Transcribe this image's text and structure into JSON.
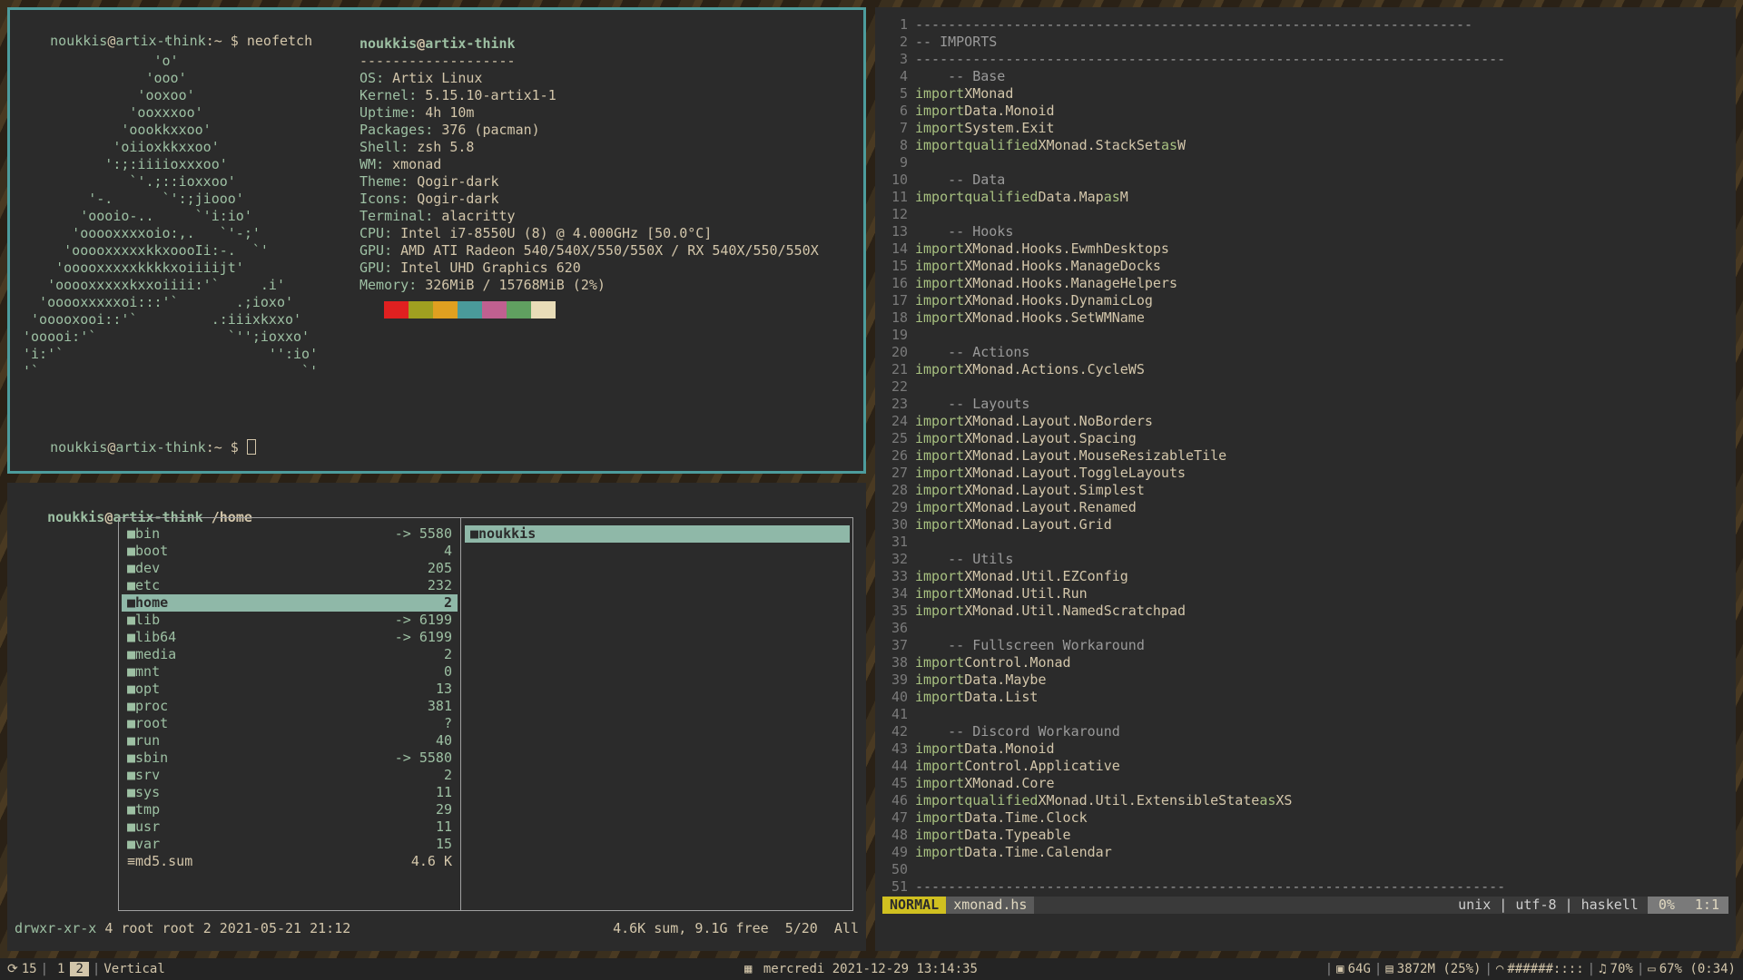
{
  "terminal": {
    "prompt_user": "noukkis",
    "prompt_at": "@",
    "prompt_host": "artix-think",
    "prompt_tail": ":~ $ ",
    "command": "neofetch",
    "logo_lines": [
      "                 '",
      "                'o'",
      "               'ooo'",
      "              'ooxoo'",
      "             'ooxxxoo'",
      "            'oookkxxoo'",
      "           'oiioxkkxxoo'",
      "          ':;:iiiioxxxoo'",
      "             `'.;::ioxxoo'",
      "        '-.      `':;jiooo'",
      "       'oooio-..     `'i:io'",
      "      'ooooxxxxoio:,.   `'-;'",
      "     'ooooxxxxxkkxoooIi:-.  `'",
      "    'ooooxxxxxkkkkxoiiiijt'",
      "   'ooooxxxxxkxxoiiii:'`     .i'",
      "  'ooooxxxxxoi:::'`       .;ioxo'",
      " 'ooooxooi::'`         .:iiixkxxo'",
      "'ooooi:'`                `'';ioxxo'",
      "'i:'`                         '':io'",
      "'`                                `'"
    ],
    "info_title_user": "noukkis",
    "info_title_at": "@",
    "info_title_host": "artix-think",
    "info_sep": "-------------------",
    "info": [
      {
        "k": "OS",
        "v": "Artix Linux"
      },
      {
        "k": "Kernel",
        "v": "5.15.10-artix1-1"
      },
      {
        "k": "Uptime",
        "v": "4h 10m"
      },
      {
        "k": "Packages",
        "v": "376 (pacman)"
      },
      {
        "k": "Shell",
        "v": "zsh 5.8"
      },
      {
        "k": "WM",
        "v": "xmonad"
      },
      {
        "k": "Theme",
        "v": "Qogir-dark"
      },
      {
        "k": "Icons",
        "v": "Qogir-dark"
      },
      {
        "k": "Terminal",
        "v": "alacritty"
      },
      {
        "k": "CPU",
        "v": "Intel i7-8550U (8) @ 4.000GHz [50.0°C]"
      },
      {
        "k": "GPU",
        "v": "AMD ATI Radeon 540/540X/550/550X / RX 540X/550/550X"
      },
      {
        "k": "GPU",
        "v": "Intel UHD Graphics 620"
      },
      {
        "k": "Memory",
        "v": "326MiB / 15768MiB (2%)"
      }
    ],
    "swatch_colors": [
      "#e02020",
      "#a0a020",
      "#e0a020",
      "#4a9a9a",
      "#c06090",
      "#60a060",
      "#e8dcb8"
    ]
  },
  "filemanager": {
    "title_user": "noukkis",
    "title_host": "artix-think",
    "title_path": "/home",
    "entries": [
      {
        "name": "bin",
        "size": "-> 5580",
        "type": "dir"
      },
      {
        "name": "boot",
        "size": "4",
        "type": "dir"
      },
      {
        "name": "dev",
        "size": "205",
        "type": "dir"
      },
      {
        "name": "etc",
        "size": "232",
        "type": "dir"
      },
      {
        "name": "home",
        "size": "2",
        "type": "dir",
        "selected": true
      },
      {
        "name": "lib",
        "size": "-> 6199",
        "type": "dir"
      },
      {
        "name": "lib64",
        "size": "-> 6199",
        "type": "dir"
      },
      {
        "name": "media",
        "size": "2",
        "type": "dir"
      },
      {
        "name": "mnt",
        "size": "0",
        "type": "dir"
      },
      {
        "name": "opt",
        "size": "13",
        "type": "dir"
      },
      {
        "name": "proc",
        "size": "381",
        "type": "dir"
      },
      {
        "name": "root",
        "size": "?",
        "type": "dir"
      },
      {
        "name": "run",
        "size": "40",
        "type": "dir"
      },
      {
        "name": "sbin",
        "size": "-> 5580",
        "type": "dir"
      },
      {
        "name": "srv",
        "size": "2",
        "type": "dir"
      },
      {
        "name": "sys",
        "size": "11",
        "type": "dir"
      },
      {
        "name": "tmp",
        "size": "29",
        "type": "dir"
      },
      {
        "name": "usr",
        "size": "11",
        "type": "dir"
      },
      {
        "name": "var",
        "size": "15",
        "type": "dir"
      },
      {
        "name": "md5.sum",
        "size": "4.6 K",
        "type": "file"
      }
    ],
    "preview": [
      {
        "name": "noukkis",
        "type": "dir"
      }
    ],
    "status_perm": "drwxr-xr-x",
    "status_info": " 4 root root 2 2021-05-21 21:12",
    "status_right": "4.6K sum, 9.1G free  5/20  All"
  },
  "editor": {
    "lines": [
      {
        "n": "1",
        "t": "cm",
        "s": "--------------------------------------------------------------------"
      },
      {
        "n": "2",
        "t": "cm",
        "s": "-- IMPORTS"
      },
      {
        "n": "3",
        "t": "cm",
        "s": "------------------------------------------------------------------------"
      },
      {
        "n": "4",
        "t": "cm",
        "s": "    -- Base"
      },
      {
        "n": "5",
        "t": "imp",
        "m": "XMonad"
      },
      {
        "n": "6",
        "t": "imp",
        "m": "Data.Monoid"
      },
      {
        "n": "7",
        "t": "imp",
        "m": "System.Exit"
      },
      {
        "n": "8",
        "t": "impq",
        "m": "XMonad.StackSet",
        "a": "W"
      },
      {
        "n": "9",
        "t": "blank",
        "s": ""
      },
      {
        "n": "10",
        "t": "cm",
        "s": "    -- Data"
      },
      {
        "n": "11",
        "t": "impq",
        "m": "Data.Map",
        "a": "M"
      },
      {
        "n": "12",
        "t": "blank",
        "s": ""
      },
      {
        "n": "13",
        "t": "cm",
        "s": "    -- Hooks"
      },
      {
        "n": "14",
        "t": "imp",
        "m": "XMonad.Hooks.EwmhDesktops"
      },
      {
        "n": "15",
        "t": "imp",
        "m": "XMonad.Hooks.ManageDocks"
      },
      {
        "n": "16",
        "t": "imp",
        "m": "XMonad.Hooks.ManageHelpers"
      },
      {
        "n": "17",
        "t": "imp",
        "m": "XMonad.Hooks.DynamicLog"
      },
      {
        "n": "18",
        "t": "imp",
        "m": "XMonad.Hooks.SetWMName"
      },
      {
        "n": "19",
        "t": "blank",
        "s": ""
      },
      {
        "n": "20",
        "t": "cm",
        "s": "    -- Actions"
      },
      {
        "n": "21",
        "t": "imp",
        "m": "XMonad.Actions.CycleWS"
      },
      {
        "n": "22",
        "t": "blank",
        "s": ""
      },
      {
        "n": "23",
        "t": "cm",
        "s": "    -- Layouts"
      },
      {
        "n": "24",
        "t": "imp",
        "m": "XMonad.Layout.NoBorders"
      },
      {
        "n": "25",
        "t": "imp",
        "m": "XMonad.Layout.Spacing"
      },
      {
        "n": "26",
        "t": "imp",
        "m": "XMonad.Layout.MouseResizableTile"
      },
      {
        "n": "27",
        "t": "imp",
        "m": "XMonad.Layout.ToggleLayouts"
      },
      {
        "n": "28",
        "t": "imp",
        "m": "XMonad.Layout.Simplest"
      },
      {
        "n": "29",
        "t": "imp",
        "m": "XMonad.Layout.Renamed"
      },
      {
        "n": "30",
        "t": "imp",
        "m": "XMonad.Layout.Grid"
      },
      {
        "n": "31",
        "t": "blank",
        "s": ""
      },
      {
        "n": "32",
        "t": "cm",
        "s": "    -- Utils"
      },
      {
        "n": "33",
        "t": "imp",
        "m": "XMonad.Util.EZConfig"
      },
      {
        "n": "34",
        "t": "imp",
        "m": "XMonad.Util.Run"
      },
      {
        "n": "35",
        "t": "imp",
        "m": "XMonad.Util.NamedScratchpad"
      },
      {
        "n": "36",
        "t": "blank",
        "s": ""
      },
      {
        "n": "37",
        "t": "cm",
        "s": "    -- Fullscreen Workaround"
      },
      {
        "n": "38",
        "t": "imp",
        "m": "Control.Monad"
      },
      {
        "n": "39",
        "t": "imp",
        "m": "Data.Maybe"
      },
      {
        "n": "40",
        "t": "imp",
        "m": "Data.List"
      },
      {
        "n": "41",
        "t": "blank",
        "s": ""
      },
      {
        "n": "42",
        "t": "cm",
        "s": "    -- Discord Workaround"
      },
      {
        "n": "43",
        "t": "imp",
        "m": "Data.Monoid"
      },
      {
        "n": "44",
        "t": "imp",
        "m": "Control.Applicative"
      },
      {
        "n": "45",
        "t": "imp",
        "m": "XMonad.Core"
      },
      {
        "n": "46",
        "t": "impq",
        "m": "XMonad.Util.ExtensibleState",
        "a": "XS"
      },
      {
        "n": "47",
        "t": "imp",
        "m": "Data.Time.Clock"
      },
      {
        "n": "48",
        "t": "imp",
        "m": "Data.Typeable"
      },
      {
        "n": "49",
        "t": "imp",
        "m": "Data.Time.Calendar"
      },
      {
        "n": "50",
        "t": "blank",
        "s": ""
      },
      {
        "n": "51",
        "t": "cm",
        "s": "------------------------------------------------------------------------"
      }
    ],
    "kw_import": "import",
    "kw_qualified": "qualified",
    "kw_as": "as",
    "status_mode": "NORMAL",
    "status_file": "xmonad.hs",
    "status_format": "unix | utf-8 | haskell",
    "status_pct": "0%",
    "status_pos": "1:1"
  },
  "bar": {
    "updates_icon": "refresh-icon",
    "updates": "15",
    "workspaces": [
      "1",
      "2"
    ],
    "active_workspace": "2",
    "layout": "Vertical",
    "date": "mercredi 2021-12-29 13:14:35",
    "disk": "64G",
    "memory": "3872M (25%)",
    "wifi": "######::::",
    "volume": "70%",
    "battery": "67% (0:34)"
  },
  "colors": {
    "accent": "#4d9c9c",
    "green": "#9dc0a3",
    "selection": "#8fb8a8",
    "mode": "#d0c020"
  }
}
